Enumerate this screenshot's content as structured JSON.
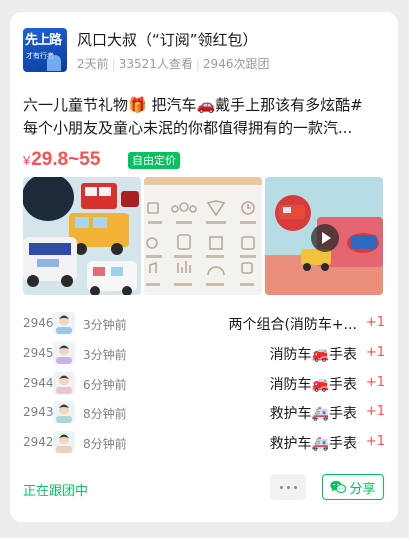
{
  "post": {
    "logo_line1": "先上路",
    "logo_line2": "才有行者",
    "title": "风口大叔（“订阅”领红包）",
    "time": "2天前",
    "views": "33521人查看",
    "follows": "2946次跟团"
  },
  "description": {
    "line1": "六一儿童节礼物🎁 把汽车🚗戴手上那该有多炫酷#",
    "line2": "每个小朋友及童心未泯的你都值得拥有的一款汽..."
  },
  "price": {
    "currency": "¥",
    "range": "29.8~55",
    "tag": "自由定价"
  },
  "orders": [
    {
      "num": "2946",
      "time": "3分钟前",
      "item": "两个组合(消防车+...",
      "qty": "+1",
      "avatar_color": "#9bc7e8"
    },
    {
      "num": "2945",
      "time": "3分钟前",
      "item": "消防车🚒手表",
      "qty": "+1",
      "avatar_color": "#c9b3e6"
    },
    {
      "num": "2944",
      "time": "6分钟前",
      "item": "消防车🚒手表",
      "qty": "+1",
      "avatar_color": "#e6c7d2"
    },
    {
      "num": "2943",
      "time": "8分钟前",
      "item": "救护车🚑手表",
      "qty": "+1",
      "avatar_color": "#a9d7d4"
    },
    {
      "num": "2942",
      "time": "8分钟前",
      "item": "救护车🚑手表",
      "qty": "+1",
      "avatar_color": "#e7d2bd"
    }
  ],
  "footer": {
    "status": "正在跟团中",
    "share_label": "分享"
  },
  "icons": {
    "more": "more-dots-icon",
    "share": "wechat-icon",
    "play": "play-icon"
  },
  "colors": {
    "accent_green": "#07c160",
    "price_red": "#fa5151"
  }
}
